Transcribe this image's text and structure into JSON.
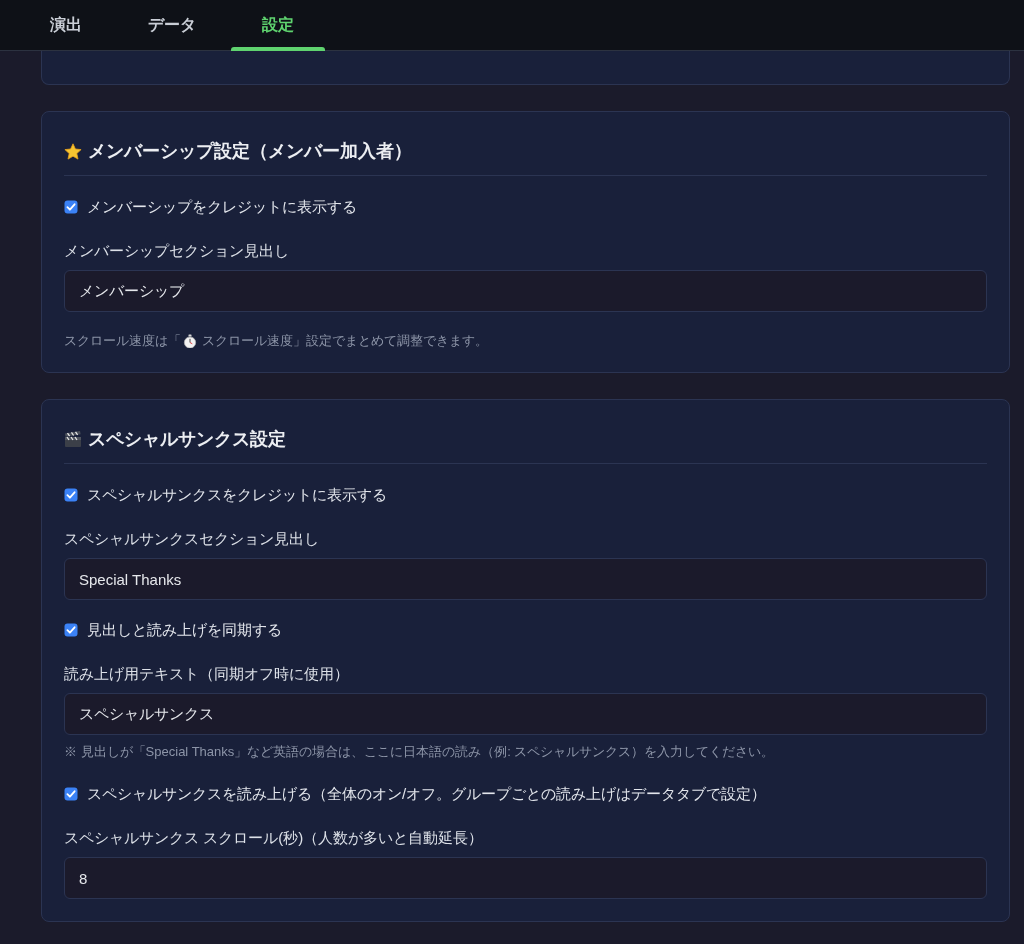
{
  "tabs": [
    {
      "label": "演出",
      "selected": false
    },
    {
      "label": "データ",
      "selected": false
    },
    {
      "label": "設定",
      "selected": true
    }
  ],
  "sections": [
    {
      "title": "メンバーシップ設定（メンバー加入者）",
      "items": [
        {
          "kind": "checkbox",
          "label": "メンバーシップをクレジットに表示する",
          "checked": true
        },
        {
          "kind": "text_field",
          "label": "メンバーシップセクション見出し",
          "value": "メンバーシップ"
        }
      ],
      "hint": [
        "スクロール速度は「",
        "スクロール速度」設定でまとめて調整できます。"
      ]
    },
    {
      "title": "スペシャルサンクス設定",
      "items": [
        {
          "kind": "checkbox",
          "label": "スペシャルサンクスをクレジットに表示する",
          "checked": true
        },
        {
          "kind": "text_field",
          "label": "スペシャルサンクスセクション見出し",
          "value": "Special Thanks"
        },
        {
          "kind": "checkbox",
          "label": "見出しと読み上げを同期する",
          "checked": true
        },
        {
          "kind": "text_field",
          "label": "読み上げ用テキスト（同期オフ時に使用）",
          "value": "スペシャルサンクス",
          "note": "※ 見出しが「Special Thanks」など英語の場合は、ここに日本語の読み（例: スペシャルサンクス）を入力してください。"
        },
        {
          "kind": "checkbox",
          "label": "スペシャルサンクスを読み上げる（全体のオン/オフ。グループごとの読み上げはデータタブで設定）",
          "checked": true
        },
        {
          "kind": "text_field",
          "label": "スペシャルサンクス スクロール(秒)（人数が多いと自動延長）",
          "value": "8"
        }
      ]
    }
  ]
}
